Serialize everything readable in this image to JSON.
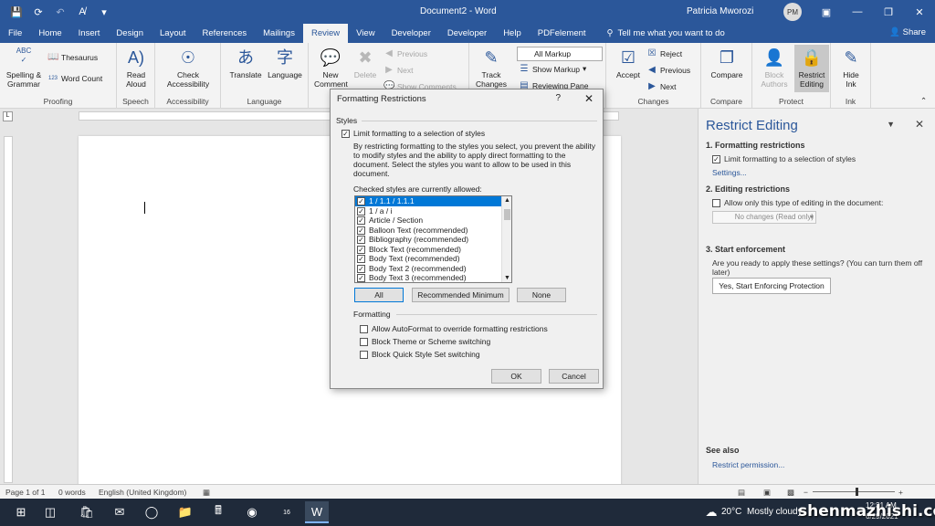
{
  "titlebar": {
    "doc_title": "Document2 - Word",
    "user_name": "Patricia Mworozi",
    "user_initials": "PM",
    "autosave_label": "A̸"
  },
  "tabs": [
    "File",
    "Home",
    "Insert",
    "Design",
    "Layout",
    "References",
    "Mailings",
    "Review",
    "View",
    "Developer",
    "Developer",
    "Help",
    "PDFelement"
  ],
  "active_tab": "Review",
  "tellme": "Tell me what you want to do",
  "share": "Share",
  "ribbon": {
    "proofing": {
      "label": "Proofing",
      "spelling": "Spelling &",
      "grammar": "Grammar",
      "thesaurus": "Thesaurus",
      "abc": "ABC",
      "word_count": "Word Count"
    },
    "speech": {
      "label": "Speech",
      "read": "Read",
      "aloud": "Aloud"
    },
    "accessibility": {
      "label": "Accessibility",
      "check": "Check",
      "accessibility_btn": "Accessibility"
    },
    "language": {
      "label": "Language",
      "translate": "Translate",
      "language_btn": "Language"
    },
    "comments": {
      "new": "New",
      "comment": "Comment",
      "delete": "Delete",
      "previous": "Previous",
      "next": "Next",
      "show_comments": "Show Comments"
    },
    "tracking": {
      "track": "Track",
      "changes": "Changes",
      "markup": "All Markup",
      "show_markup": "Show Markup",
      "reviewing_pane": "Reviewing Pane"
    },
    "changes": {
      "label": "Changes",
      "accept": "Accept",
      "reject": "Reject",
      "previous": "Previous",
      "next": "Next"
    },
    "compare": {
      "label": "Compare",
      "compare_btn": "Compare"
    },
    "protect": {
      "label": "Protect",
      "block": "Block",
      "authors": "Authors",
      "restrict": "Restrict",
      "editing": "Editing"
    },
    "ink": {
      "label": "Ink",
      "hide": "Hide",
      "ink_btn": "Ink"
    }
  },
  "pane": {
    "title": "Restrict Editing",
    "s1": "1. Formatting restrictions",
    "s1_check": "Limit formatting to a selection of styles",
    "s1_link": "Settings...",
    "s2": "2. Editing restrictions",
    "s2_check": "Allow only this type of editing in the document:",
    "s2_select": "No changes (Read only)",
    "s3": "3. Start enforcement",
    "s3_text": "Are you ready to apply these settings? (You can turn them off later)",
    "s3_button": "Yes, Start Enforcing Protection",
    "see_also": "See also",
    "restrict_perm": "Restrict permission..."
  },
  "dialog": {
    "title": "Formatting Restrictions",
    "help": "?",
    "styles_section": "Styles",
    "limit_check": "Limit formatting to a selection of styles",
    "description": "By restricting formatting to the styles you select, you prevent the ability to modify styles and the ability to apply direct formatting to the document. Select the styles you want to allow to be used in this document.",
    "checked_label": "Checked styles are currently allowed:",
    "styles": [
      "1 / 1.1 / 1.1.1",
      "1 / a / i",
      "Article / Section",
      "Balloon Text (recommended)",
      "Bibliography (recommended)",
      "Block Text (recommended)",
      "Body Text (recommended)",
      "Body Text 2 (recommended)",
      "Body Text 3 (recommended)"
    ],
    "btn_all": "All",
    "btn_recommended": "Recommended Minimum",
    "btn_none": "None",
    "formatting_section": "Formatting",
    "fmt1": "Allow AutoFormat to override formatting restrictions",
    "fmt2": "Block Theme or Scheme switching",
    "fmt3": "Block Quick Style Set switching",
    "ok": "OK",
    "cancel": "Cancel"
  },
  "status": {
    "page": "Page 1 of 1",
    "words": "0 words",
    "language": "English (United Kingdom)",
    "zoom_minus": "−",
    "zoom_plus": "+"
  },
  "taskbar": {
    "temperature": "20°C",
    "weather": "Mostly cloudy",
    "time": "12:31 AM",
    "date": "6/29/2021",
    "badge": "16"
  },
  "watermark": "shenmazhishi.com",
  "colors": {
    "word_blue": "#2b579a",
    "selection": "#0078d7"
  }
}
